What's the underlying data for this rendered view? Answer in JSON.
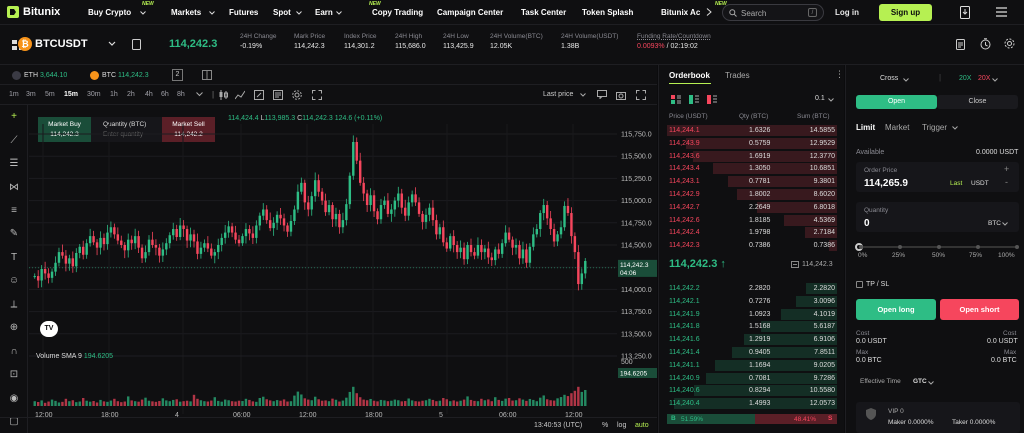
{
  "nav": {
    "brand": "Bitunix",
    "items": [
      {
        "label": "Buy Crypto",
        "new": true,
        "chevron": true
      },
      {
        "label": "Markets",
        "new": false,
        "chevron": true
      },
      {
        "label": "Futures",
        "new": false,
        "chevron": false
      },
      {
        "label": "Spot",
        "new": false,
        "chevron": true
      },
      {
        "label": "Earn",
        "new": true,
        "chevron": true
      },
      {
        "label": "Copy Trading",
        "new": false,
        "chevron": false
      },
      {
        "label": "Campaign Center",
        "new": false,
        "chevron": false
      },
      {
        "label": "Task Center",
        "new": false,
        "chevron": false
      },
      {
        "label": "Token Splash",
        "new": false,
        "chevron": false
      },
      {
        "label": "Bitunix Ac",
        "new": true,
        "chevron": false
      }
    ],
    "new_badge": "NEW",
    "search_placeholder": "Search",
    "search_kbd": "/",
    "login": "Log in",
    "signup": "Sign up",
    "accent": "#b6f052"
  },
  "ticker": {
    "symbol": "BTCUSDT",
    "last_price": "114,242.3",
    "stats": [
      {
        "label": "24H Change",
        "value": "-0.19%",
        "tone": "red"
      },
      {
        "label": "Mark Price",
        "value": "114,242.3",
        "tone": "normal"
      },
      {
        "label": "Index Price",
        "value": "114,301.2",
        "tone": "normal"
      },
      {
        "label": "24H High",
        "value": "115,686.0",
        "tone": "normal"
      },
      {
        "label": "24H Low",
        "value": "113,425.9",
        "tone": "normal"
      },
      {
        "label": "24H Volume(BTC)",
        "value": "12.05K",
        "tone": "normal"
      },
      {
        "label": "24H Volume(USDT)",
        "value": "1.38B",
        "tone": "normal"
      }
    ],
    "funding_label": "Funding Rate/Countdown",
    "funding_rate": "0.0093%",
    "funding_sep": " / ",
    "countdown": "02:19:02"
  },
  "subbar": {
    "eth_label": "ETH",
    "eth_price": "3,644.10",
    "btc_label": "BTC",
    "btc_price": "114,242.3",
    "chart_badge": "2"
  },
  "toolbar": {
    "timeframes": [
      "1m",
      "3m",
      "5m",
      "15m",
      "30m",
      "1h",
      "2h",
      "4h",
      "6h",
      "8h"
    ],
    "active_timeframe": "15m",
    "price_mode": "Last price"
  },
  "quick_order": {
    "buy_label": "Market Buy",
    "buy_price": "114,242.3",
    "qty_label": "Quantity (BTC)",
    "qty_placeholder": "Enter quantity",
    "sell_label": "Market Sell",
    "sell_price": "114,242.2"
  },
  "ohlc": {
    "open_label": "",
    "open": "114,424.4",
    "low_label": "L",
    "low": "113,985.3",
    "close_label": "C",
    "close": "114,242.3",
    "change": "124.6 (+0.11%)"
  },
  "chart_data": {
    "type": "candlestick",
    "yaxis_ticks": [
      "115,750.0",
      "115,500.0",
      "115,250.0",
      "115,000.0",
      "114,750.0",
      "114,500.0",
      "114,250.0",
      "114,000.0",
      "113,750.0",
      "113,500.0",
      "113,250.0"
    ],
    "ylim": [
      113250,
      115750
    ],
    "xaxis_ticks": [
      "12:00",
      "18:00",
      "4",
      "06:00",
      "12:00",
      "18:00",
      "5",
      "06:00",
      "12:00"
    ],
    "price_tag": "114,242.3",
    "price_tag_time": "04:06",
    "volume_label": "Volume SMA 9",
    "volume_sma": "194.6205",
    "volume_axis": "500",
    "volume_tag": "194.6205",
    "series": [
      {
        "name": "price",
        "values": [
          114150,
          114100,
          114230,
          114180,
          114130,
          114200,
          114300,
          114420,
          114380,
          114290,
          114350,
          114260,
          114410,
          114480,
          114390,
          114520,
          114600,
          114530,
          114470,
          114580,
          114510,
          114640,
          114700,
          114620,
          114550,
          114500,
          114440,
          114560,
          114520,
          114600,
          114470,
          114350,
          114420,
          114560,
          114500,
          114470,
          114380,
          114450,
          114520,
          114610,
          114680,
          114590,
          114720,
          114680,
          114550,
          114620,
          114540,
          114400,
          114470,
          114520,
          114460,
          114380,
          114420,
          114500,
          114580,
          114640,
          114710,
          114640,
          114560,
          114520,
          114600,
          114680,
          114630,
          114580,
          114720,
          114830,
          114900,
          114780,
          114690,
          114750,
          114840,
          114800,
          114720,
          114650,
          114770,
          114900,
          115100,
          115200,
          114980,
          114900,
          115050,
          115230,
          115100,
          115000,
          114870,
          114950,
          114790,
          114850,
          114700,
          114780,
          114960,
          115280,
          115660,
          115450,
          115200,
          115080,
          114950,
          115060,
          114880,
          114790,
          114950,
          115000,
          114850,
          114900,
          115000,
          115080,
          114920,
          114830,
          114980,
          115070,
          114980,
          114850,
          114760,
          114840,
          114920,
          114780,
          114620,
          114700,
          114530,
          114460,
          114600,
          114500,
          114420,
          114470,
          114340,
          114500,
          114420,
          114380,
          114500,
          114420,
          114460,
          114360,
          114330,
          114450,
          114400,
          114520,
          114640,
          114560,
          114470,
          114500,
          114350,
          114450,
          114300,
          114480,
          114620,
          114680,
          114860,
          114950,
          114800,
          114680,
          114540,
          114620,
          114700,
          114940,
          114860,
          114600,
          114420,
          114060,
          114180,
          114320
        ]
      }
    ],
    "volume": [
      30,
      25,
      35,
      20,
      28,
      40,
      32,
      22,
      26,
      45,
      30,
      36,
      24,
      28,
      50,
      33,
      27,
      31,
      22,
      38,
      29,
      26,
      34,
      45,
      30,
      24,
      28,
      60,
      35,
      30,
      27,
      40,
      52,
      33,
      29,
      26,
      31,
      48,
      35,
      30,
      38,
      42,
      27,
      30,
      33,
      29,
      70,
      45,
      36,
      30,
      28,
      34,
      55,
      32,
      27,
      40,
      36,
      30,
      28,
      33,
      31,
      45,
      38,
      29,
      26,
      50,
      58,
      42,
      35,
      30,
      37,
      33,
      41,
      28,
      30,
      65,
      90,
      72,
      48,
      40,
      36,
      58,
      42,
      33,
      35,
      30,
      46,
      39,
      28,
      34,
      52,
      88,
      120,
      80,
      55,
      40,
      36,
      44,
      33,
      29,
      38,
      35,
      30,
      33,
      40,
      36,
      29,
      31,
      47,
      35,
      30,
      28,
      33,
      36,
      45,
      38,
      30,
      33,
      50,
      42,
      30,
      35,
      28,
      33,
      40,
      60,
      38,
      32,
      30,
      45,
      36,
      41,
      30,
      55,
      38,
      32,
      46,
      50,
      34,
      36,
      48,
      40,
      32,
      44,
      38,
      30,
      52,
      66,
      42,
      36,
      34,
      48,
      56,
      70,
      62,
      80,
      95,
      120,
      88,
      100
    ],
    "volume_max": 500
  },
  "chart_footer": {
    "time": "13:40:53 (UTC)",
    "percent": "%",
    "log": "log",
    "auto": "auto"
  },
  "orderbook": {
    "tab_active": "Orderbook",
    "tab_other": "Trades",
    "precision": "0.1",
    "headers": [
      "Price (USDT)",
      "Qty (BTC)",
      "Sum (BTC)"
    ],
    "asks": [
      {
        "price": "114,244.1",
        "qty": "1.6326",
        "sum": "14.5855",
        "depth": 1.0
      },
      {
        "price": "114,243.9",
        "qty": "0.5759",
        "sum": "12.9529",
        "depth": 0.89
      },
      {
        "price": "114,243.6",
        "qty": "1.6919",
        "sum": "12.3770",
        "depth": 0.85
      },
      {
        "price": "114,243.4",
        "qty": "1.3050",
        "sum": "10.6851",
        "depth": 0.73
      },
      {
        "price": "114,243.1",
        "qty": "0.7781",
        "sum": "9.3801",
        "depth": 0.64
      },
      {
        "price": "114,242.9",
        "qty": "1.8002",
        "sum": "8.6020",
        "depth": 0.59
      },
      {
        "price": "114,242.7",
        "qty": "2.2649",
        "sum": "6.8018",
        "depth": 0.47
      },
      {
        "price": "114,242.6",
        "qty": "1.8185",
        "sum": "4.5369",
        "depth": 0.31
      },
      {
        "price": "114,242.4",
        "qty": "1.9798",
        "sum": "2.7184",
        "depth": 0.19
      },
      {
        "price": "114,242.3",
        "qty": "0.7386",
        "sum": "0.7386",
        "depth": 0.05
      }
    ],
    "mid_price": "114,242.3",
    "mid_arrow": "↑",
    "mid_mark": "114,242.3",
    "bids": [
      {
        "price": "114,242.2",
        "qty": "2.2820",
        "sum": "2.2820",
        "depth": 0.18
      },
      {
        "price": "114,242.1",
        "qty": "0.7276",
        "sum": "3.0096",
        "depth": 0.24
      },
      {
        "price": "114,241.9",
        "qty": "1.0923",
        "sum": "4.1019",
        "depth": 0.33
      },
      {
        "price": "114,241.8",
        "qty": "1.5168",
        "sum": "5.6187",
        "depth": 0.45
      },
      {
        "price": "114,241.6",
        "qty": "1.2919",
        "sum": "6.9106",
        "depth": 0.55
      },
      {
        "price": "114,241.4",
        "qty": "0.9405",
        "sum": "7.8511",
        "depth": 0.62
      },
      {
        "price": "114,241.1",
        "qty": "1.1694",
        "sum": "9.0205",
        "depth": 0.72
      },
      {
        "price": "114,240.9",
        "qty": "0.7081",
        "sum": "9.7286",
        "depth": 0.77
      },
      {
        "price": "114,240.6",
        "qty": "0.8294",
        "sum": "10.5580",
        "depth": 0.84
      },
      {
        "price": "114,240.4",
        "qty": "1.4993",
        "sum": "12.0573",
        "depth": 0.96
      }
    ],
    "ratio_buy": "51.59%",
    "ratio_sell": "48.41%",
    "ratio_buy_frac": 0.5159
  },
  "trade": {
    "margin_mode": "Cross",
    "leverage_long": "20X",
    "leverage_short": "20X",
    "tab_open": "Open",
    "tab_close": "Close",
    "order_types": [
      "Limit",
      "Market",
      "Trigger"
    ],
    "available_label": "Available",
    "available_value": "0.0000 USDT",
    "order_price_label": "Order Price",
    "order_price": "114,265.9",
    "last_label": "Last",
    "price_unit": "USDT",
    "quantity_label": "Quantity",
    "quantity": "0",
    "qty_unit": "BTC",
    "slider_marks": [
      "0%",
      "25%",
      "50%",
      "75%",
      "100%"
    ],
    "slider_value": 0,
    "tpsl_label": "TP / SL",
    "open_long": "Open long",
    "open_short": "Open short",
    "cost_label": "Cost",
    "cost_long": "0.0 USDT",
    "cost_short": "0.0 USDT",
    "max_label": "Max",
    "max_long": "0.0 BTC",
    "max_short": "0.0 BTC",
    "eff_time_label": "Effective Time",
    "eff_time_value": "GTC",
    "vip_label": "VIP 0",
    "maker": "Maker 0.0000%",
    "taker": "Taker 0.0000%",
    "long_color": "#2ebd85",
    "short_color": "#f6465d"
  }
}
